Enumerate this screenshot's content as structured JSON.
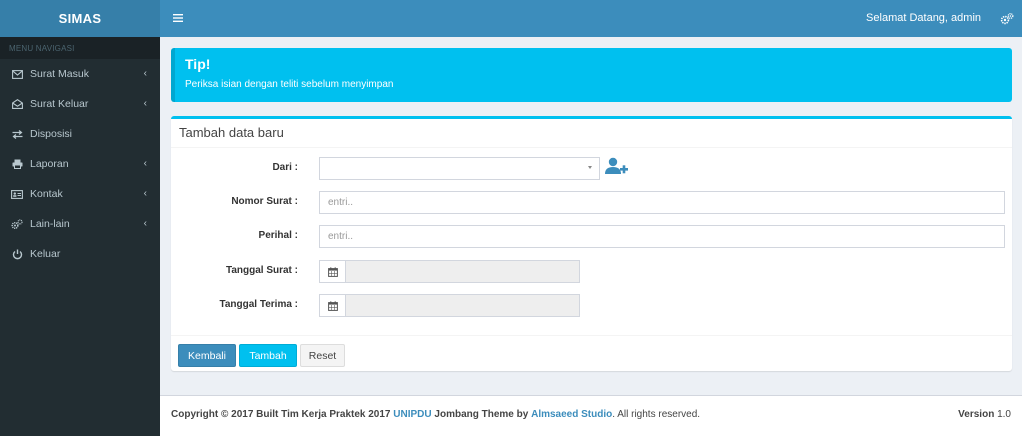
{
  "app": {
    "logo": "SIMAS"
  },
  "topbar": {
    "welcome": "Selamat Datang, admin"
  },
  "sidebar": {
    "header": "MENU NAVIGASI",
    "items": [
      {
        "label": "Surat Masuk",
        "icon": "envelope-icon",
        "has_children": true
      },
      {
        "label": "Surat Keluar",
        "icon": "envelope-open-icon",
        "has_children": true
      },
      {
        "label": "Disposisi",
        "icon": "exchange-icon",
        "has_children": false
      },
      {
        "label": "Laporan",
        "icon": "print-icon",
        "has_children": true
      },
      {
        "label": "Kontak",
        "icon": "address-card-icon",
        "has_children": true
      },
      {
        "label": "Lain-lain",
        "icon": "cogs-icon",
        "has_children": true
      },
      {
        "label": "Keluar",
        "icon": "power-off-icon",
        "has_children": false
      }
    ]
  },
  "callout": {
    "title": "Tip!",
    "body": "Periksa isian dengan teliti sebelum menyimpan"
  },
  "form": {
    "title": "Tambah data baru",
    "dari_label": "Dari :",
    "nomor_label": "Nomor Surat :",
    "nomor_placeholder": "entri..",
    "perihal_label": "Perihal :",
    "perihal_placeholder": "entri..",
    "tanggal_surat_label": "Tanggal Surat :",
    "tanggal_terima_label": "Tanggal Terima :"
  },
  "buttons": {
    "kembali": "Kembali",
    "tambah": "Tambah",
    "reset": "Reset"
  },
  "footer": {
    "copyright_prefix": "Copyright © 2017 Built Tim Kerja Praktek 2017",
    "unipdu": "UNIPDU",
    "jombang": "Jombang Theme by",
    "studio": "Almsaeed Studio",
    "rights": ". All rights reserved.",
    "version_label": "Version",
    "version_value": "1.0"
  },
  "colors": {
    "primary": "#3c8dbc",
    "info": "#00c0ef",
    "sidebar": "#222d32"
  }
}
